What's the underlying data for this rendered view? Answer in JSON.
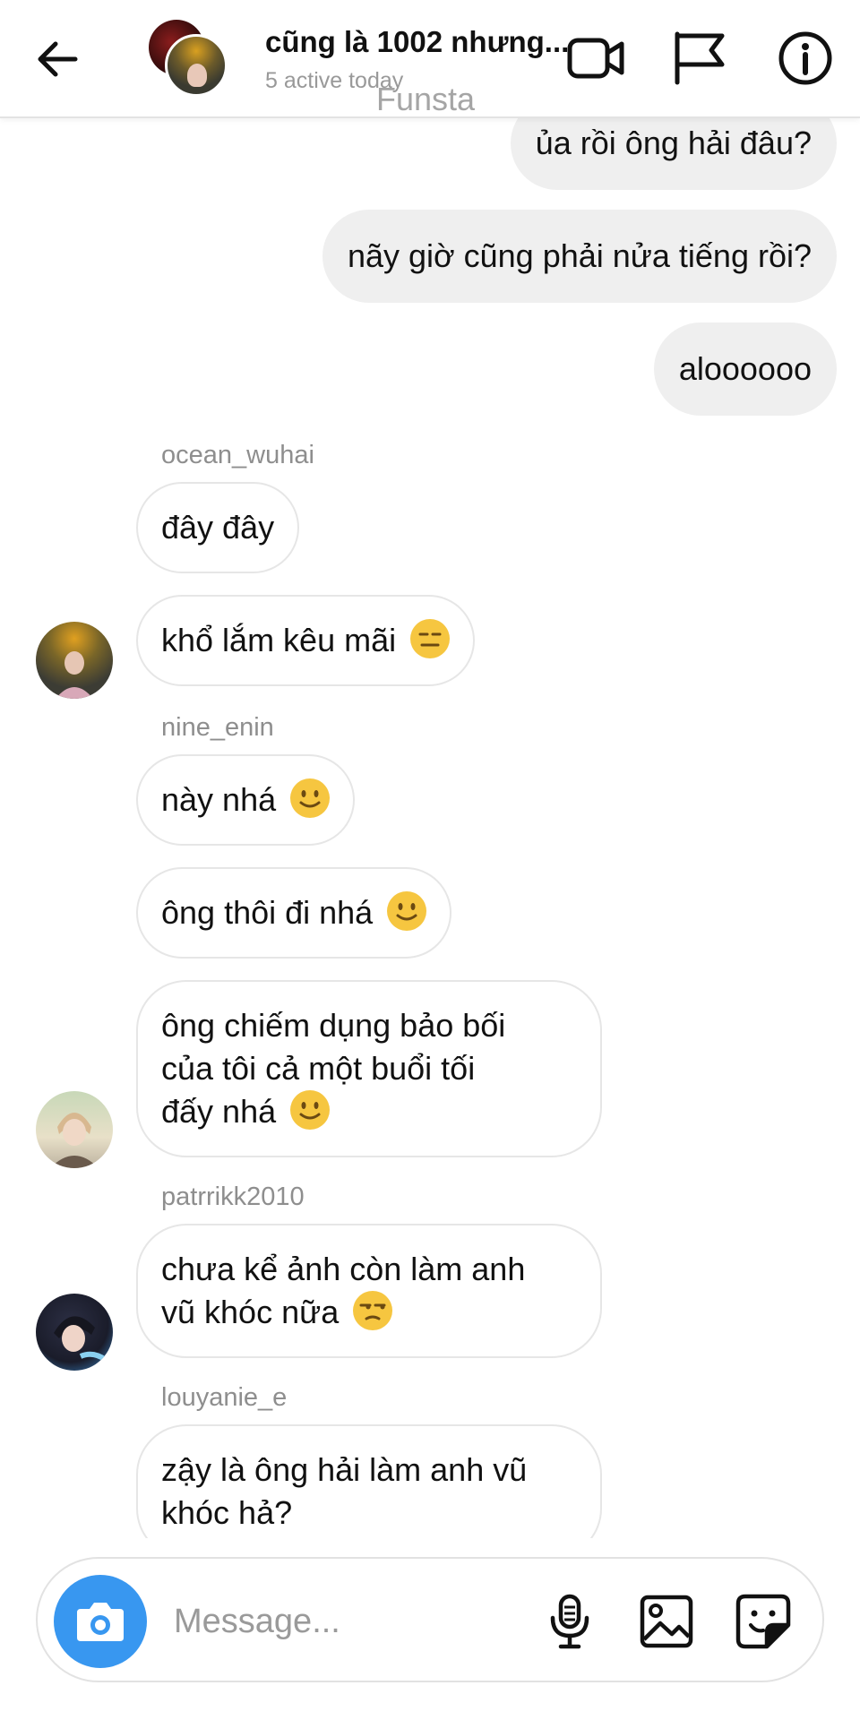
{
  "header": {
    "back_icon": "arrow-left-icon",
    "title": "cũng là 1002 nhưng...",
    "status": "5 active today",
    "watermark": "Funsta",
    "icons": [
      "video-call-icon",
      "flag-icon",
      "info-icon"
    ]
  },
  "messages": [
    {
      "direction": "outgoing",
      "text": "ủa rồi ông hải đâu?"
    },
    {
      "direction": "outgoing",
      "text": "nãy giờ cũng phải nửa tiếng rồi?"
    },
    {
      "direction": "outgoing",
      "text": "aloooooo"
    },
    {
      "direction": "incoming",
      "sender": "ocean_wuhai",
      "lines": [
        "đây đây"
      ]
    },
    {
      "direction": "incoming",
      "lines": [
        "khổ lắm kêu mãi"
      ],
      "emoji": "expressionless-face"
    },
    {
      "direction": "incoming",
      "sender": "nine_enin",
      "lines": [
        "này nhá"
      ],
      "emoji": "slightly-smiling-face"
    },
    {
      "direction": "incoming",
      "lines": [
        "ông thôi đi nhá"
      ],
      "emoji": "slightly-smiling-face"
    },
    {
      "direction": "incoming",
      "lines": [
        "ông chiếm dụng bảo bối",
        "của tôi cả một buổi tối",
        "đấy nhá"
      ],
      "emoji": "slightly-smiling-face"
    },
    {
      "direction": "incoming",
      "sender": "patrrikk2010",
      "lines": [
        "chưa kể ảnh còn làm anh",
        "vũ khóc nữa"
      ],
      "emoji": "unamused-face"
    },
    {
      "direction": "incoming",
      "sender": "louyanie_e",
      "lines": [
        "zậy là ông hải làm anh vũ",
        "khóc hả?"
      ]
    }
  ],
  "composer": {
    "placeholder": "Message...",
    "value": "",
    "icons": [
      "camera-icon",
      "microphone-icon",
      "gallery-icon",
      "sticker-icon"
    ]
  },
  "colors": {
    "accent": "#3897f0",
    "outgoing_bubble": "#efefef",
    "incoming_border": "#e6e6e6",
    "secondary_text": "#8e8e8e"
  }
}
